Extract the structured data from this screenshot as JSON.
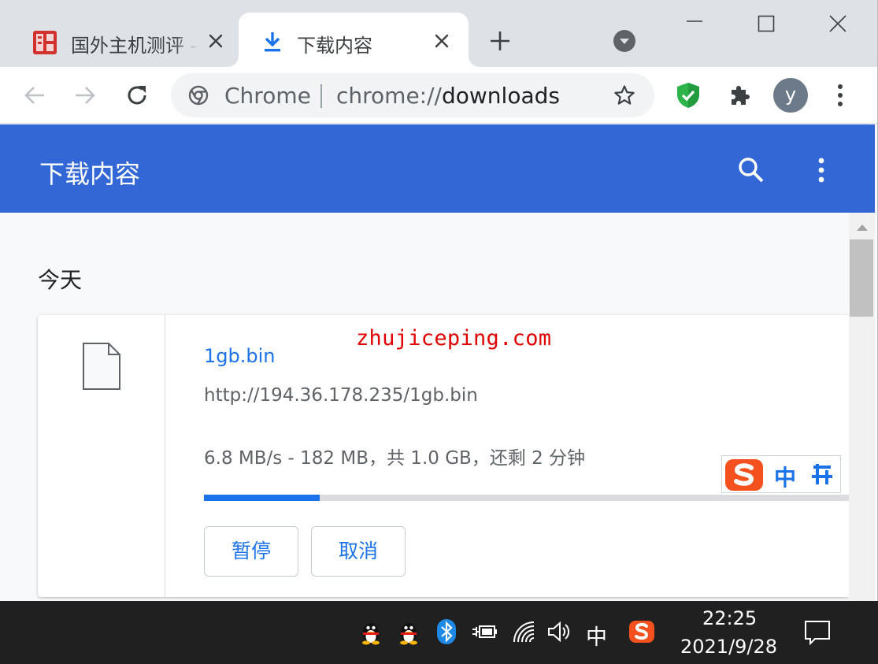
{
  "tabs": [
    {
      "title": "国外主机测评 - ",
      "active": false,
      "favicon": "site-seal-icon"
    },
    {
      "title": "下载内容",
      "active": true,
      "favicon": "download-icon"
    }
  ],
  "toolbar": {
    "omnibox_chip": "Chrome",
    "url_scheme": "chrome://",
    "url_path": "downloads",
    "avatar_letter": "y"
  },
  "page": {
    "title": "下载内容",
    "date_group": "今天"
  },
  "download": {
    "filename": "1gb.bin",
    "url": "http://194.36.178.235/1gb.bin",
    "status": "6.8 MB/s - 182 MB，共 1.0 GB，还剩 2 分钟",
    "progress": 0.18,
    "pause_label": "暂停",
    "cancel_label": "取消"
  },
  "watermark": "zhujiceping.com",
  "ime": {
    "mode": "中"
  },
  "taskbar": {
    "input_language": "中",
    "time": "22:25",
    "date": "2021/9/28"
  },
  "colors": {
    "header_blue": "#3367d6",
    "link_blue": "#1a73e8",
    "watermark_red": "#e00000",
    "shield_green": "#2db44b",
    "sogou_orange": "#f4511e"
  }
}
